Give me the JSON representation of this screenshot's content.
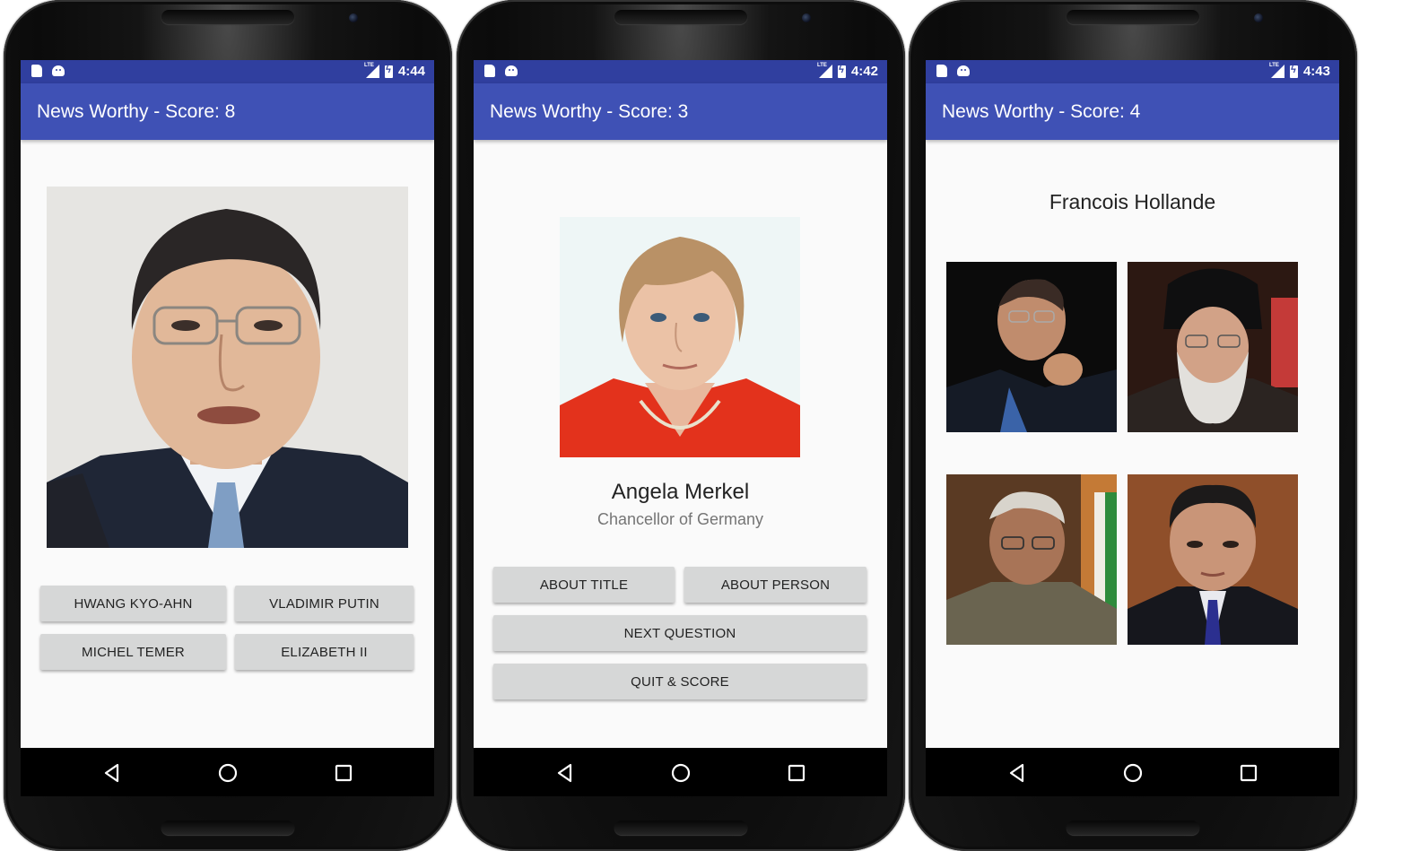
{
  "phones": [
    {
      "status_time": "4:44",
      "app_title": "News Worthy - Score: 8",
      "answers": [
        "HWANG KYO-AHN",
        "VLADIMIR PUTIN",
        "MICHEL TEMER",
        "ELIZABETH II"
      ]
    },
    {
      "status_time": "4:42",
      "app_title": "News Worthy - Score: 3",
      "person_name": "Angela Merkel",
      "person_title": "Chancellor of Germany",
      "buttons": {
        "about_title": "ABOUT TITLE",
        "about_person": "ABOUT PERSON",
        "next_question": "NEXT QUESTION",
        "quit_score": "QUIT & SCORE"
      }
    },
    {
      "status_time": "4:43",
      "app_title": "News Worthy - Score: 4",
      "question_name": "Francois Hollande"
    }
  ],
  "status_lte": "LTE",
  "colors": {
    "status_bar": "#303f9f",
    "app_bar": "#3f51b5",
    "button": "#d6d7d7",
    "screen_bg": "#fafafa"
  },
  "icons": [
    "sd-card-icon",
    "android-icon",
    "lte-signal-icon",
    "battery-charging-icon",
    "back-icon",
    "home-icon",
    "recents-icon"
  ]
}
